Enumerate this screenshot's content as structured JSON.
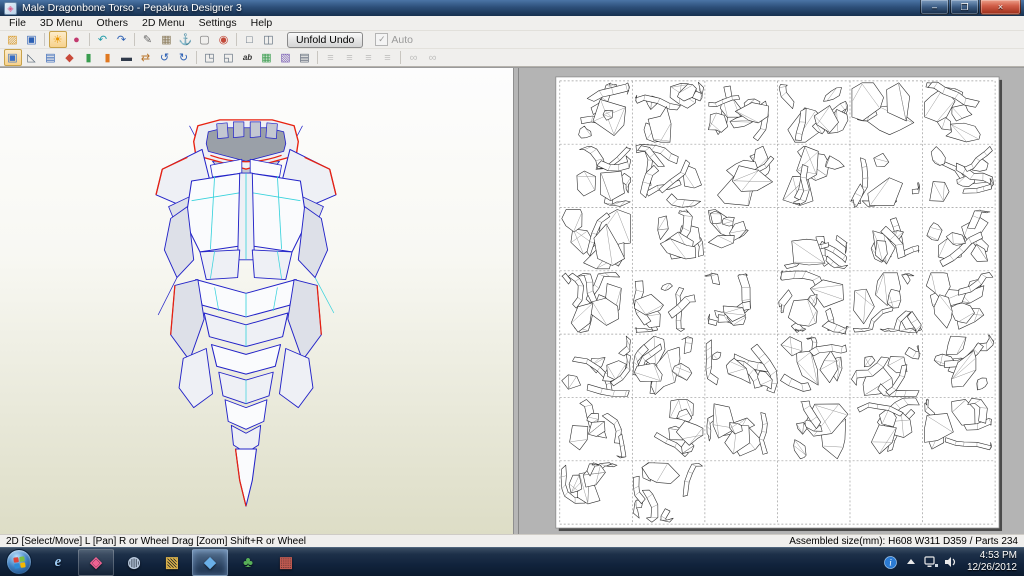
{
  "window": {
    "title": "Male Dragonbone Torso - Pepakura Designer 3",
    "minimize_glyph": "–",
    "maximize_glyph": "❐",
    "close_glyph": "×"
  },
  "menu_bar": {
    "items": [
      "File",
      "3D Menu",
      "Others",
      "2D Menu",
      "Settings",
      "Help"
    ]
  },
  "toolbar_main": {
    "unfold_undo_label": "Unfold Undo",
    "auto_label": "Auto",
    "auto_checked_glyph": "✓",
    "icons": [
      {
        "name": "open-file-icon",
        "glyph": "▨",
        "color": "#d99a2b"
      },
      {
        "name": "save-icon",
        "glyph": "▣",
        "color": "#2b5fb4"
      },
      {
        "sep": true
      },
      {
        "name": "light-toggle-icon",
        "glyph": "☀",
        "color": "#e89500",
        "pressed": true
      },
      {
        "name": "material-sphere-icon",
        "glyph": "●",
        "color": "#c23a6e"
      },
      {
        "sep": true
      },
      {
        "name": "rotate-view-left-icon",
        "glyph": "↶",
        "color": "#1f9aa8"
      },
      {
        "name": "rotate-view-right-icon",
        "glyph": "↷",
        "color": "#2b5fb4"
      },
      {
        "sep": true
      },
      {
        "name": "pen-icon",
        "glyph": "✎",
        "color": "#666666"
      },
      {
        "name": "stamp-icon",
        "glyph": "▦",
        "color": "#8a7a5a"
      },
      {
        "name": "anchor-icon",
        "glyph": "⚓",
        "color": "#33506e"
      },
      {
        "name": "box-select-icon",
        "glyph": "▢",
        "color": "#777777"
      },
      {
        "name": "magnet-icon",
        "glyph": "◉",
        "color": "#c24a3a"
      },
      {
        "sep": true
      },
      {
        "name": "single-window-icon",
        "glyph": "□",
        "color": "#5a6a7a"
      },
      {
        "name": "split-window-icon",
        "glyph": "◫",
        "color": "#5a6a7a"
      }
    ]
  },
  "toolbar_2d": {
    "icons": [
      {
        "name": "select-move-icon",
        "glyph": "▣",
        "color": "#3a6fc4",
        "pressed": true
      },
      {
        "name": "edit-flap-icon",
        "glyph": "◺",
        "color": "#5a6a7a"
      },
      {
        "name": "monitor-icon",
        "glyph": "▤",
        "color": "#2b5fb4"
      },
      {
        "name": "paint-icon",
        "glyph": "◆",
        "color": "#c94a3a"
      },
      {
        "name": "part-green-icon",
        "glyph": "▮",
        "color": "#3a9d4f"
      },
      {
        "name": "part-orange-icon",
        "glyph": "▮",
        "color": "#e07820"
      },
      {
        "name": "dark-screen-icon",
        "glyph": "▬",
        "color": "#2f3a4a"
      },
      {
        "name": "flip-piece-icon",
        "glyph": "⇄",
        "color": "#b8742a"
      },
      {
        "name": "rotate-piece-ccw-icon",
        "glyph": "↺",
        "color": "#2b5fb4"
      },
      {
        "name": "rotate-piece-cw-icon",
        "glyph": "↻",
        "color": "#2b5fb4"
      },
      {
        "sep": true
      },
      {
        "name": "zoom-selection-icon",
        "glyph": "◳",
        "color": "#5a6a7a"
      },
      {
        "name": "zoom-fit-icon",
        "glyph": "◱",
        "color": "#5a6a7a"
      },
      {
        "name": "edge-id-icon",
        "glyph": "ab",
        "color": "#333333",
        "text": true
      },
      {
        "name": "texture-page-icon",
        "glyph": "▦",
        "color": "#3a9d4f"
      },
      {
        "name": "image-page-icon",
        "glyph": "▧",
        "color": "#7a5fb4"
      },
      {
        "name": "print-icon",
        "glyph": "▤",
        "color": "#556070"
      },
      {
        "sep": true
      },
      {
        "name": "align-left-icon",
        "glyph": "≡",
        "color": "#9a9a9a",
        "disabled": true
      },
      {
        "name": "align-center-icon",
        "glyph": "≡",
        "color": "#9a9a9a",
        "disabled": true
      },
      {
        "name": "align-right-icon",
        "glyph": "≡",
        "color": "#9a9a9a",
        "disabled": true
      },
      {
        "name": "align-bottom-icon",
        "glyph": "≡",
        "color": "#9a9a9a",
        "disabled": true
      },
      {
        "sep": true
      },
      {
        "name": "join-edge-icon",
        "glyph": "∞",
        "color": "#9a9a9a",
        "disabled": true
      },
      {
        "name": "split-edge-icon",
        "glyph": "∞",
        "color": "#9a9a9a",
        "disabled": true
      }
    ]
  },
  "viewer_3d": {
    "bg_top": "#fdfdfd",
    "bg_bottom": "#ddddc6",
    "edge_blue": "#2323c8",
    "fold_cyan": "#38d2dc",
    "open_edge_red": "#e8210f"
  },
  "pattern_layout": {
    "columns": 6,
    "rows": 7,
    "last_row_filled_cells": 2,
    "sheet_color": "#ffffff",
    "outline_color": "#2e2e2e",
    "grid_color": "#9c9c9c",
    "backdrop_color": "#b4b4b4"
  },
  "status_bar": {
    "left": "2D [Select/Move] L [Pan] R or Wheel Drag [Zoom] Shift+R or Wheel",
    "right": "Assembled size(mm): H608 W311 D359 / Parts 234"
  },
  "taskbar": {
    "apps": [
      {
        "name": "internet-explorer",
        "glyph": "e",
        "color": "#9cc8f0",
        "italic": true
      },
      {
        "name": "pepakura-viewer",
        "glyph": "◈",
        "color": "#f06292",
        "open": true
      },
      {
        "name": "hp-globe-tool",
        "glyph": "◍",
        "color": "#b8c8dc"
      },
      {
        "name": "photo-viewer",
        "glyph": "▧",
        "color": "#d9b04a"
      },
      {
        "name": "pepakura-designer",
        "glyph": "◆",
        "color": "#6ab0e8",
        "active": true
      },
      {
        "name": "nature-app",
        "glyph": "♣",
        "color": "#58b058"
      },
      {
        "name": "media-player",
        "glyph": "▦",
        "color": "#c05a50"
      }
    ],
    "tray_time": "4:53 PM",
    "tray_date": "12/26/2012"
  }
}
